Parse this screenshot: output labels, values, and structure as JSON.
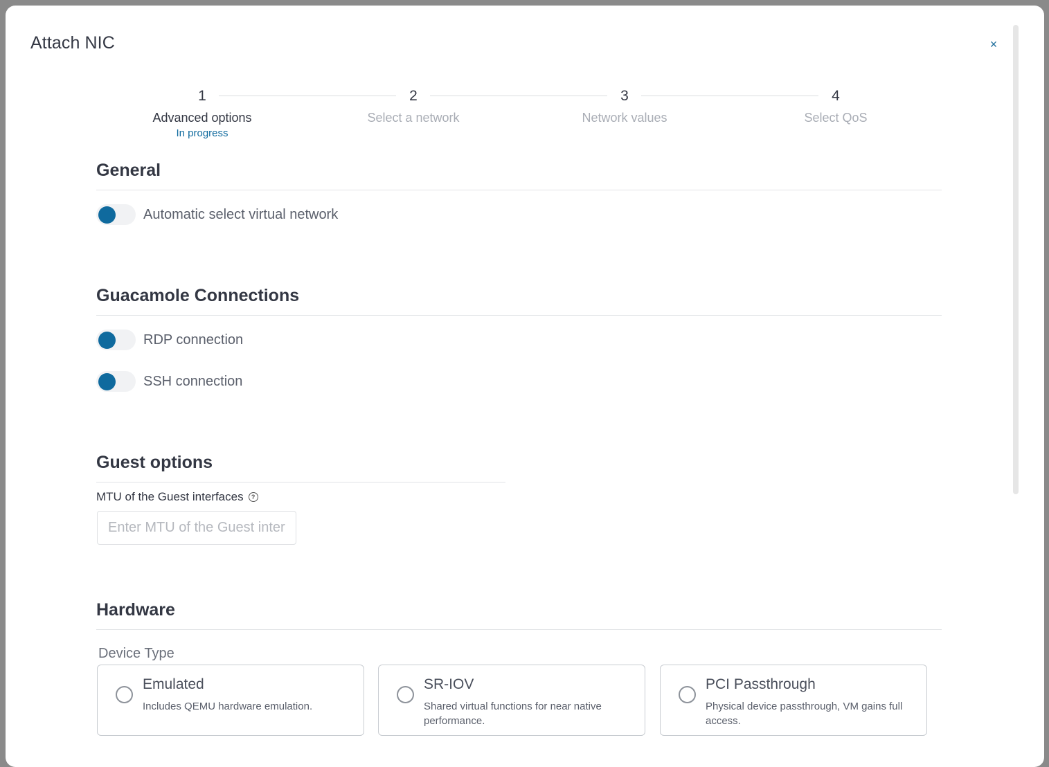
{
  "dialog": {
    "title": "Attach NIC",
    "close_label": "×"
  },
  "stepper": {
    "steps": [
      {
        "number": "1",
        "label": "Advanced options",
        "status": "In progress"
      },
      {
        "number": "2",
        "label": "Select a network"
      },
      {
        "number": "3",
        "label": "Network values"
      },
      {
        "number": "4",
        "label": "Select QoS"
      }
    ]
  },
  "general": {
    "title": "General",
    "auto_select_label": "Automatic select virtual network"
  },
  "guacamole": {
    "title": "Guacamole Connections",
    "rdp_label": "RDP connection",
    "ssh_label": "SSH connection"
  },
  "guest": {
    "title": "Guest options",
    "mtu_label": "MTU of the Guest interfaces",
    "mtu_placeholder": "Enter MTU of the Guest interfaces",
    "mtu_value": ""
  },
  "hardware": {
    "title": "Hardware",
    "device_type_label": "Device Type",
    "options": [
      {
        "title": "Emulated",
        "description": "Includes QEMU hardware emulation."
      },
      {
        "title": "SR-IOV",
        "description": "Shared virtual functions for near native performance."
      },
      {
        "title": "PCI Passthrough",
        "description": "Physical device passthrough, VM gains full access."
      }
    ]
  },
  "colors": {
    "accent": "#0f6a9e",
    "text_primary": "#333743",
    "text_muted": "#a9adb5"
  }
}
